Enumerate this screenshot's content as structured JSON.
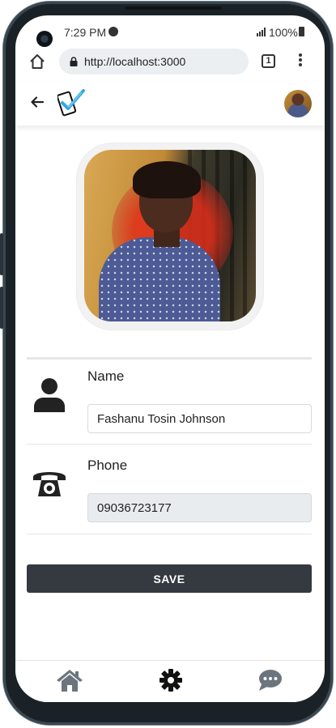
{
  "status_bar": {
    "time": "7:29 PM",
    "battery": "100%",
    "spotify_icon": "spotify-icon",
    "signal_icon": "signal-icon",
    "battery_icon": "battery-icon"
  },
  "browser": {
    "url": "http://localhost:3000",
    "tab_count": "1",
    "home_icon": "home-outline-icon",
    "lock_icon": "lock-icon",
    "menu_icon": "more-vertical-icon"
  },
  "app_bar": {
    "back_icon": "arrow-left-icon",
    "logo": "phone-check-logo",
    "avatar": "user-avatar"
  },
  "profile": {
    "photo": "profile-photo"
  },
  "fields": {
    "name": {
      "label": "Name",
      "value": "Fashanu Tosin Johnson",
      "icon": "user-icon"
    },
    "phone": {
      "label": "Phone",
      "value": "09036723177",
      "icon": "telephone-icon",
      "readonly": true
    }
  },
  "actions": {
    "save_label": "SAVE"
  },
  "bottom_nav": {
    "items": [
      {
        "name": "home",
        "icon": "home-icon",
        "active": false
      },
      {
        "name": "settings",
        "icon": "gear-icon",
        "active": true
      },
      {
        "name": "messages",
        "icon": "chat-icon",
        "active": false
      }
    ]
  },
  "colors": {
    "dark": "#343a40",
    "muted_icon": "#6c757d",
    "input_readonly_bg": "#e9ecef",
    "logo_accent": "#2fa8e0"
  }
}
